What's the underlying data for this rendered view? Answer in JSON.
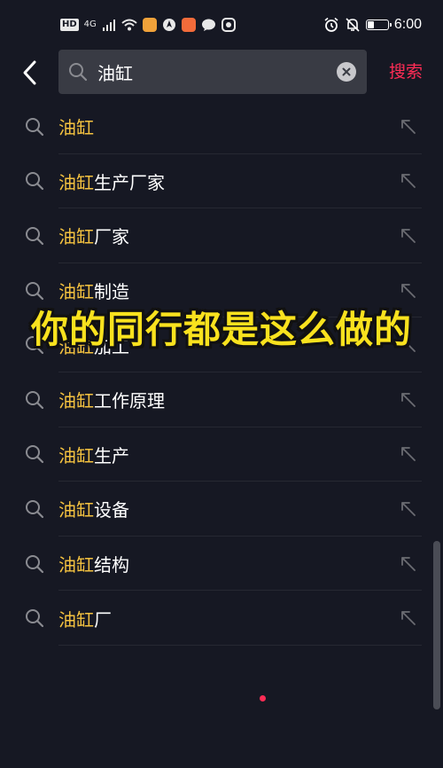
{
  "status_bar": {
    "hd": "HD",
    "net": "4G",
    "time": "6:00"
  },
  "search": {
    "value": "油缸",
    "action_label": "搜索"
  },
  "suggestions": [
    {
      "highlight": "油缸",
      "rest": ""
    },
    {
      "highlight": "油缸",
      "rest": "生产厂家"
    },
    {
      "highlight": "油缸",
      "rest": "厂家"
    },
    {
      "highlight": "油缸",
      "rest": "制造"
    },
    {
      "highlight": "油缸",
      "rest": "加工"
    },
    {
      "highlight": "油缸",
      "rest": "工作原理"
    },
    {
      "highlight": "油缸",
      "rest": "生产"
    },
    {
      "highlight": "油缸",
      "rest": "设备"
    },
    {
      "highlight": "油缸",
      "rest": "结构"
    },
    {
      "highlight": "油缸",
      "rest": "厂"
    }
  ],
  "overlay": {
    "caption": "你的同行都是这么做的"
  },
  "colors": {
    "background": "#161823",
    "highlight": "#f4c240",
    "accent": "#fe2c55",
    "caption": "#f9e21e"
  },
  "icons": {
    "back": "chevron-left-icon",
    "search": "search-icon",
    "clear": "close-circle-icon",
    "fill": "arrow-up-left-icon"
  }
}
